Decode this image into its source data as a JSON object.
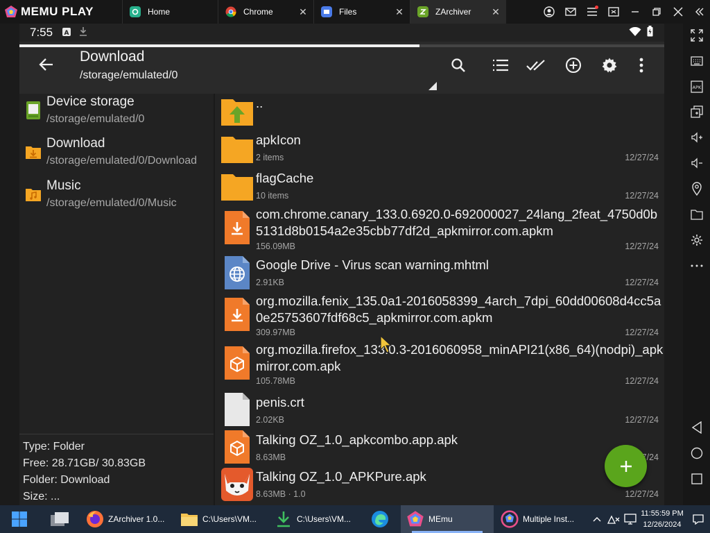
{
  "emulator": {
    "brand": "MEMU PLAY",
    "tabs": [
      {
        "label": "Home",
        "icon": "home-tab-icon"
      },
      {
        "label": "Chrome",
        "icon": "chrome-icon"
      },
      {
        "label": "Files",
        "icon": "files-icon"
      },
      {
        "label": "ZArchiver",
        "icon": "zarchiver-icon"
      }
    ]
  },
  "statusbar": {
    "time": "7:55"
  },
  "appbar": {
    "title": "Download",
    "path": "/storage/emulated/0",
    "progress": 0.62
  },
  "left_pane": {
    "items": [
      {
        "name": "Device storage",
        "path": "/storage/emulated/0"
      },
      {
        "name": "Download",
        "path": "/storage/emulated/0/Download"
      },
      {
        "name": "Music",
        "path": "/storage/emulated/0/Music"
      }
    ],
    "info": {
      "type": "Type: Folder",
      "free": "Free: 28.71GB/ 30.83GB",
      "folder": "Folder: Download",
      "size": "Size: ..."
    }
  },
  "files": [
    {
      "name": "..",
      "meta": "",
      "date": "",
      "icon": "parent-folder-icon"
    },
    {
      "name": "apkIcon",
      "meta": "2 items",
      "date": "12/27/24",
      "icon": "folder-icon"
    },
    {
      "name": "flagCache",
      "meta": "10 items",
      "date": "12/27/24",
      "icon": "folder-icon"
    },
    {
      "name": "com.chrome.canary_133.0.6920.0-692000027_24lang_2feat_4750d0b5131d8b0154a2e35cbb77df2d_apkmirror.com.apkm",
      "meta": "156.09MB",
      "date": "12/27/24",
      "icon": "apkm-file-icon"
    },
    {
      "name": "Google Drive - Virus scan warning.mhtml",
      "meta": "2.91KB",
      "date": "12/27/24",
      "icon": "web-file-icon"
    },
    {
      "name": "org.mozilla.fenix_135.0a1-2016058399_4arch_7dpi_60dd00608d4cc5a0e25753607fdf68c5_apkmirror.com.apkm",
      "meta": "309.97MB",
      "date": "12/27/24",
      "icon": "apkm-file-icon"
    },
    {
      "name": "org.mozilla.firefox_133.0.3-2016060958_minAPI21(x86_64)(nodpi)_apkmirror.com.apk",
      "meta": "105.78MB",
      "date": "12/27/24",
      "icon": "apk-file-icon"
    },
    {
      "name": "penis.crt",
      "meta": "2.02KB",
      "date": "12/27/24",
      "icon": "generic-file-icon"
    },
    {
      "name": "Talking OZ_1.0_apkcombo.app.apk",
      "meta": "8.63MB",
      "date": "12/27/24",
      "icon": "apk-file-icon"
    },
    {
      "name": "Talking OZ_1.0_APKPure.apk",
      "meta": "8.63MB  ·  1.0",
      "date": "12/27/24",
      "icon": "app-thumbnail-icon"
    }
  ],
  "taskbar": {
    "items": [
      {
        "label": "ZArchiver 1.0...",
        "icon": "firefox-icon"
      },
      {
        "label": "C:\\Users\\VM...",
        "icon": "folder-icon"
      },
      {
        "label": "C:\\Users\\VM...",
        "icon": "download-icon"
      },
      {
        "label": "MEmu",
        "icon": "memu-icon"
      },
      {
        "label": "Multiple Inst...",
        "icon": "multi-instance-icon"
      }
    ],
    "clock_time": "11:55:59 PM",
    "clock_date": "12/26/2024"
  },
  "colors": {
    "accent_green": "#5aa51c",
    "folder_orange": "#f5a623",
    "apk_orange": "#f07a2a",
    "background": "#222222"
  }
}
